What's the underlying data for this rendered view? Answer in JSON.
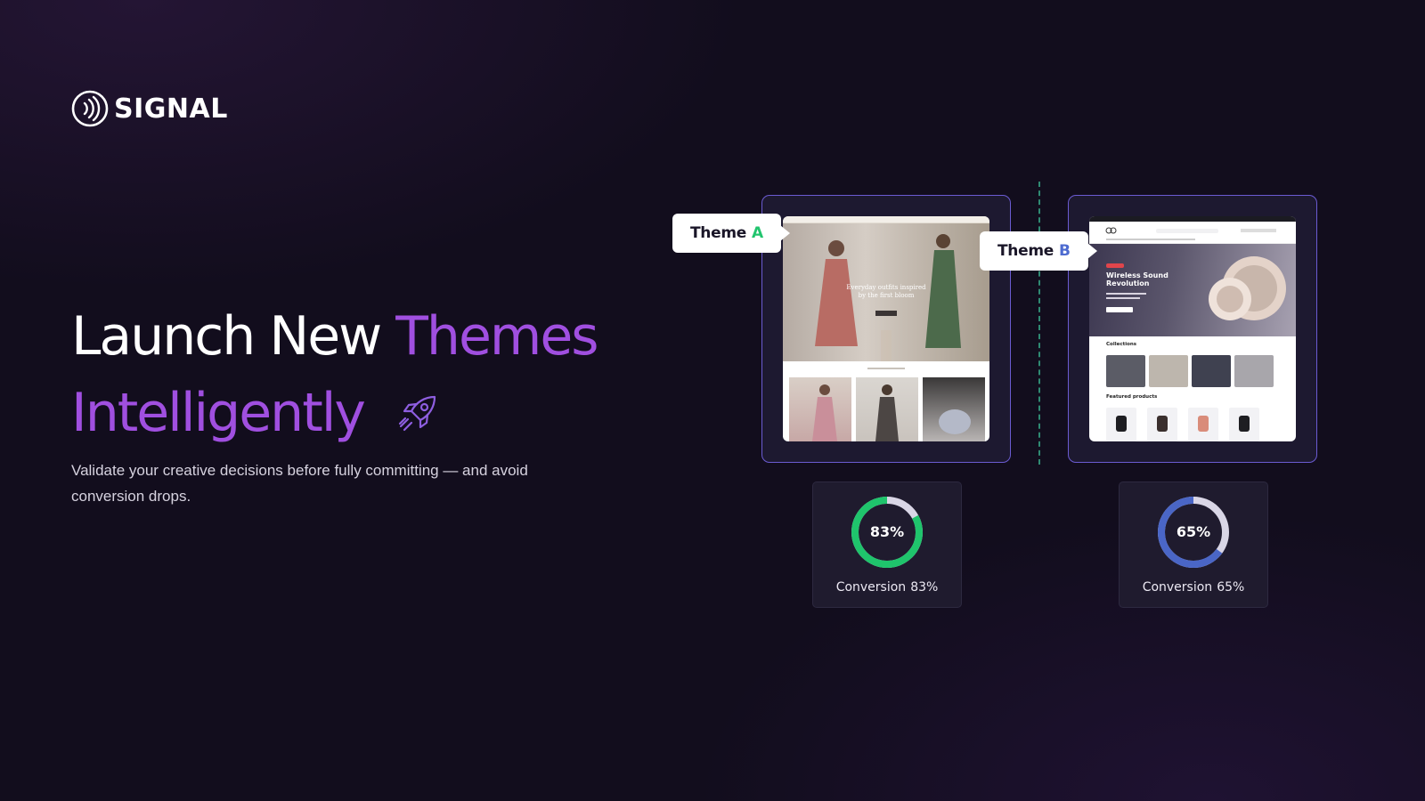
{
  "brand": {
    "name": "SIGNAL",
    "logo_icon": "signal-waves-icon"
  },
  "headline": {
    "part1": "Launch New ",
    "part2": "Themes",
    "part3": "Intelligently",
    "icon": "rocket-icon",
    "accent_color": "#a04fe0"
  },
  "subtitle": "Validate your creative decisions before fully committing — and avoid conversion drops.",
  "themes": [
    {
      "tag_word": "Theme",
      "tag_letter": "A",
      "letter_color": "#22c46e",
      "preview": "fashion-store-preview",
      "conversion_value": 83,
      "conversion_display": "83%",
      "conversion_label": "Conversion",
      "ring_color": "#1fc46c"
    },
    {
      "tag_word": "Theme",
      "tag_letter": "B",
      "letter_color": "#4d6bd0",
      "preview": "electronics-store-preview",
      "conversion_value": 65,
      "conversion_display": "65%",
      "conversion_label": "Conversion",
      "ring_color": "#4a66c6",
      "preview_texts": {
        "hero_title": "Wireless Sound Revolution",
        "collections": "Collections",
        "featured": "Featured products"
      }
    }
  ],
  "colors": {
    "background": "#120d1d",
    "card_border": "#6b5bd2",
    "divider": "#2f8a72"
  }
}
